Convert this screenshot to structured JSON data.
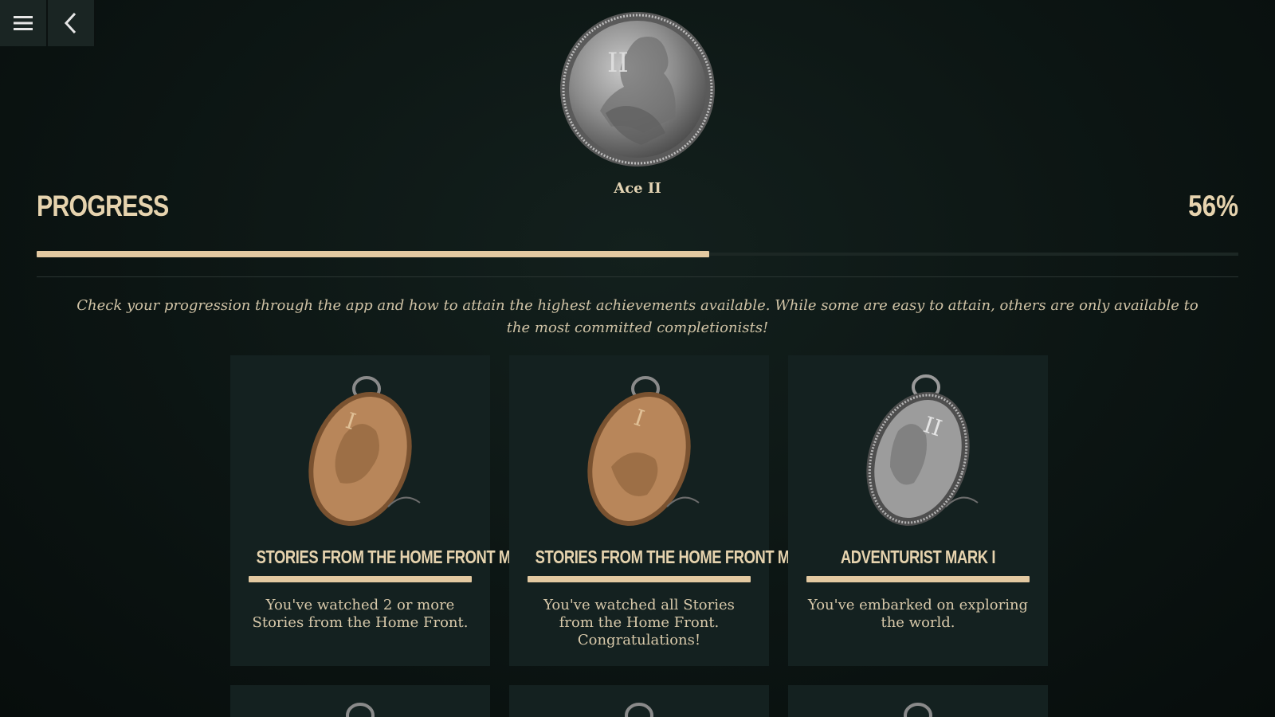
{
  "topbar": {
    "menu_icon": "hamburger-menu-icon",
    "back_icon": "chevron-left-icon"
  },
  "hero": {
    "medal_name": "Ace II",
    "numeral": "II"
  },
  "progress": {
    "title": "PROGRESS",
    "percent_label": "56%",
    "percent_value": 56
  },
  "intro": "Check your progression through the app and how to attain the highest achievements available. While some are easy to attain, others are only available to the most committed completionists!",
  "colors": {
    "accent": "#e3c9a1",
    "card_bg": "#142120",
    "bronze": "#b8865a",
    "silver": "#9c9c9c"
  },
  "achievements": [
    {
      "title": "STORIES FROM THE HOME FRONT MARK I",
      "description": "You've watched 2 or more Stories from the Home Front.",
      "tier": "bronze",
      "numeral": "I"
    },
    {
      "title": "STORIES FROM THE HOME FRONT MARK II",
      "description": "You've watched all Stories from the Home Front. Congratulations!",
      "tier": "bronze",
      "numeral": "I"
    },
    {
      "title": "ADVENTURIST MARK I",
      "description": "You've embarked on exploring the world.",
      "tier": "silver",
      "numeral": "II"
    }
  ]
}
